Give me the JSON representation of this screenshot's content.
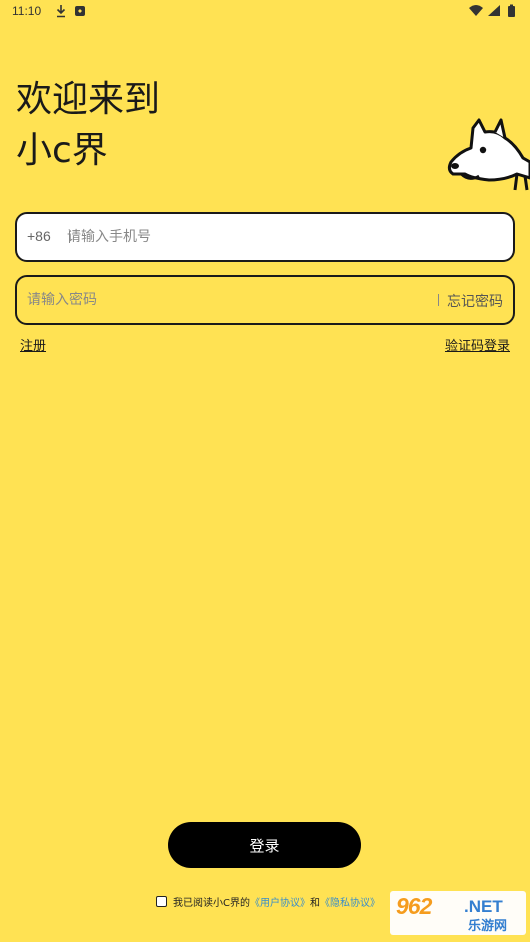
{
  "status_bar": {
    "time": "11:10",
    "icons": [
      "download-icon",
      "app-notification-icon",
      "wifi-icon",
      "signal-icon",
      "battery-icon"
    ]
  },
  "header": {
    "welcome": "欢迎来到",
    "brand": "小c界"
  },
  "form": {
    "phone_prefix": "+86",
    "phone_placeholder": "请输入手机号",
    "password_placeholder": "请输入密码",
    "forgot_password": "忘记密码",
    "register": "注册",
    "code_login": "验证码登录"
  },
  "login_button": "登录",
  "agreement": {
    "prefix": "我已阅读小C界的",
    "user_agreement": "《用户协议》",
    "and": "和",
    "privacy_agreement": "《隐私协议》",
    "checked": false
  },
  "watermark": {
    "number": "962",
    "net": ".NET",
    "cn": "乐游网"
  },
  "colors": {
    "background": "#FFE253",
    "button": "#000000",
    "link": "#3a8ec9"
  }
}
